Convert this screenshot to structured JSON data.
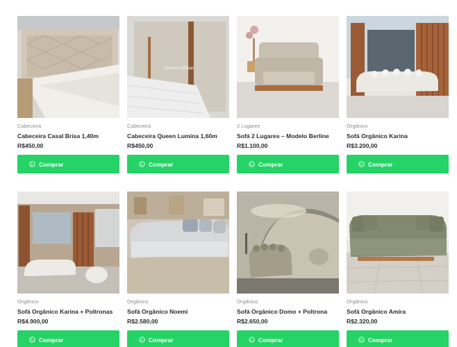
{
  "products": [
    {
      "category": "Cabeceira",
      "title": "Cabeceira Casal Brisa 1,40m",
      "price": "R$450,00",
      "button": "Comprar"
    },
    {
      "category": "Cabeceira",
      "title": "Cabeceira Queen Lumina 1,60m",
      "price": "R$450,00",
      "button": "Comprar",
      "watermark": "Giovanni Maltan"
    },
    {
      "category": "2 Lugares",
      "title": "Sofá 2 Lugares – Modelo Berline",
      "price": "R$1.100,00",
      "button": "Comprar"
    },
    {
      "category": "Orgânico",
      "title": "Sofá Orgânico Karina",
      "price": "R$3.200,00",
      "button": "Comprar"
    },
    {
      "category": "Orgânico",
      "title": "Sofá Orgânico Karina + Poltronas",
      "price": "R$4.900,00",
      "button": "Comprar"
    },
    {
      "category": "Orgânico",
      "title": "Sofá Orgânico Noemi",
      "price": "R$2.580,00",
      "button": "Comprar"
    },
    {
      "category": "Orgânico",
      "title": "Sofá Orgânico Domo + Poltrona",
      "price": "R$2.650,00",
      "button": "Comprar"
    },
    {
      "category": "Orgânico",
      "title": "Sofá Orgânico Amira",
      "price": "R$2.320,00",
      "button": "Comprar"
    }
  ],
  "colors": {
    "buy_button": "#25d366"
  },
  "icons": {
    "buy_button": "whatsapp-icon"
  }
}
